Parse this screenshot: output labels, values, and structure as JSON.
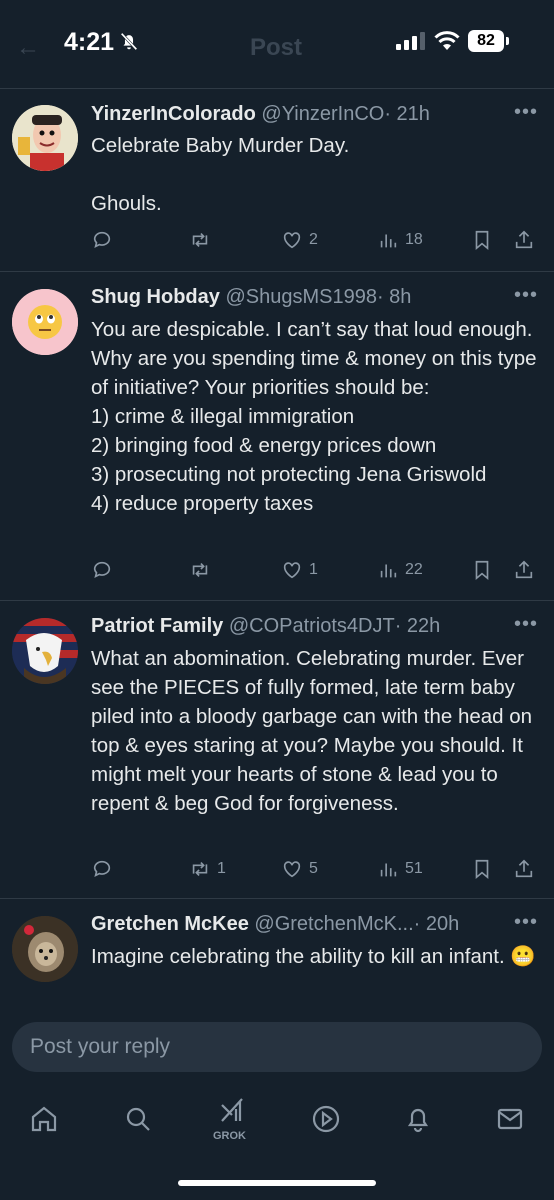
{
  "status": {
    "time": "4:21",
    "battery": "82"
  },
  "header": {
    "title": "Post"
  },
  "posts": [
    {
      "name": "YinzerInColorado",
      "handle": "@YinzerInCO",
      "time": "· 21h",
      "text": "Celebrate Baby Murder Day.\n\nGhouls.",
      "replies": "",
      "reposts": "",
      "likes": "2",
      "views": "18"
    },
    {
      "name": "Shug Hobday",
      "handle": "@ShugsMS1998",
      "time": "· 8h",
      "text": "You are despicable. I can’t say that loud enough. Why are you spending time & money on this type of initiative? Your priorities should be:\n1) crime & illegal immigration\n2) bringing food & energy prices down\n3) prosecuting not protecting Jena Griswold\n4) reduce property taxes",
      "replies": "",
      "reposts": "",
      "likes": "1",
      "views": "22"
    },
    {
      "name": "Patriot Family",
      "handle": "@COPatriots4DJT",
      "time": "· 22h",
      "text": "What an abomination. Celebrating murder. Ever see the PIECES of fully formed, late term baby piled into a bloody garbage can with the head on top & eyes staring at you? Maybe you should. It might melt your hearts of stone & lead you to repent & beg God for forgiveness.",
      "replies": "",
      "reposts": "1",
      "likes": "5",
      "views": "51"
    },
    {
      "name": "Gretchen McKee",
      "handle": "@GretchenMcK...",
      "time": "· 20h",
      "text": "Imagine celebrating the ability to kill an infant. 😬"
    }
  ],
  "reply_box": {
    "placeholder": "Post your reply"
  },
  "tabbar": {
    "grok_label": "GROK"
  },
  "icons": [
    "mute-bell-icon",
    "signal-icon",
    "wifi-icon",
    "more-icon",
    "reply-icon",
    "repost-icon",
    "like-icon",
    "views-icon",
    "bookmark-icon",
    "share-icon",
    "home-icon",
    "search-icon",
    "grok-icon",
    "video-icon",
    "notifications-icon",
    "messages-icon"
  ],
  "colors": {
    "background": "#15202b",
    "text": "#e7e9ea",
    "muted": "#8b98a5",
    "divider": "#2f3a45",
    "reply_box": "#273340"
  }
}
